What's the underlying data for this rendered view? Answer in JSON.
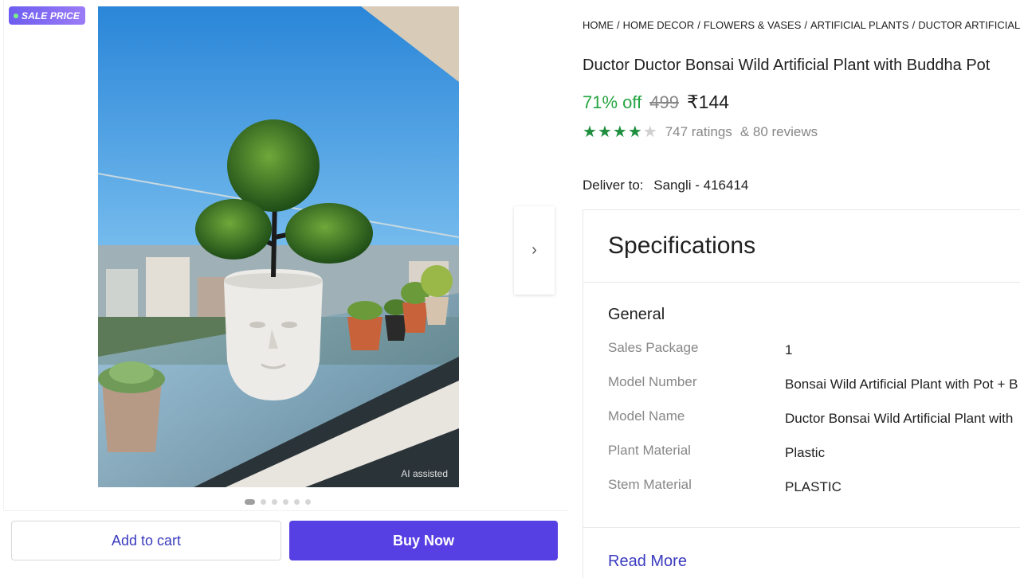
{
  "badge": {
    "label": "SALE PRICE"
  },
  "image": {
    "ai_label": "AI assisted"
  },
  "carousel": {
    "next_glyph": "›",
    "dot_count": 6,
    "active_index": 0
  },
  "actions": {
    "add_to_cart": "Add to cart",
    "buy_now": "Buy Now"
  },
  "breadcrumb": [
    "HOME",
    "HOME DECOR",
    "FLOWERS & VASES",
    "ARTIFICIAL PLANTS",
    "DUCTOR ARTIFICIAL PLA"
  ],
  "product": {
    "title": "Ductor Ductor Bonsai Wild Artificial Plant with Buddha Pot",
    "discount": "71% off",
    "mrp": "499",
    "price": "₹144",
    "rating_value": 4,
    "rating_max": 5,
    "ratings_text": "747 ratings",
    "reviews_text": "& 80 reviews"
  },
  "delivery": {
    "label": "Deliver to:",
    "location": "Sangli - 416414"
  },
  "specifications": {
    "heading": "Specifications",
    "group": "General",
    "rows": [
      {
        "key": "Sales Package",
        "value": "1"
      },
      {
        "key": "Model Number",
        "value": "Bonsai Wild Artificial Plant with Pot + B"
      },
      {
        "key": "Model Name",
        "value": "Ductor Bonsai Wild Artificial Plant with"
      },
      {
        "key": "Plant Material",
        "value": "Plastic"
      },
      {
        "key": "Stem Material",
        "value": "PLASTIC"
      }
    ],
    "read_more": "Read More"
  },
  "colors": {
    "accent": "#5740e3",
    "link": "#3b3bbf",
    "discount": "#26a541",
    "star": "#1e8e3e"
  }
}
